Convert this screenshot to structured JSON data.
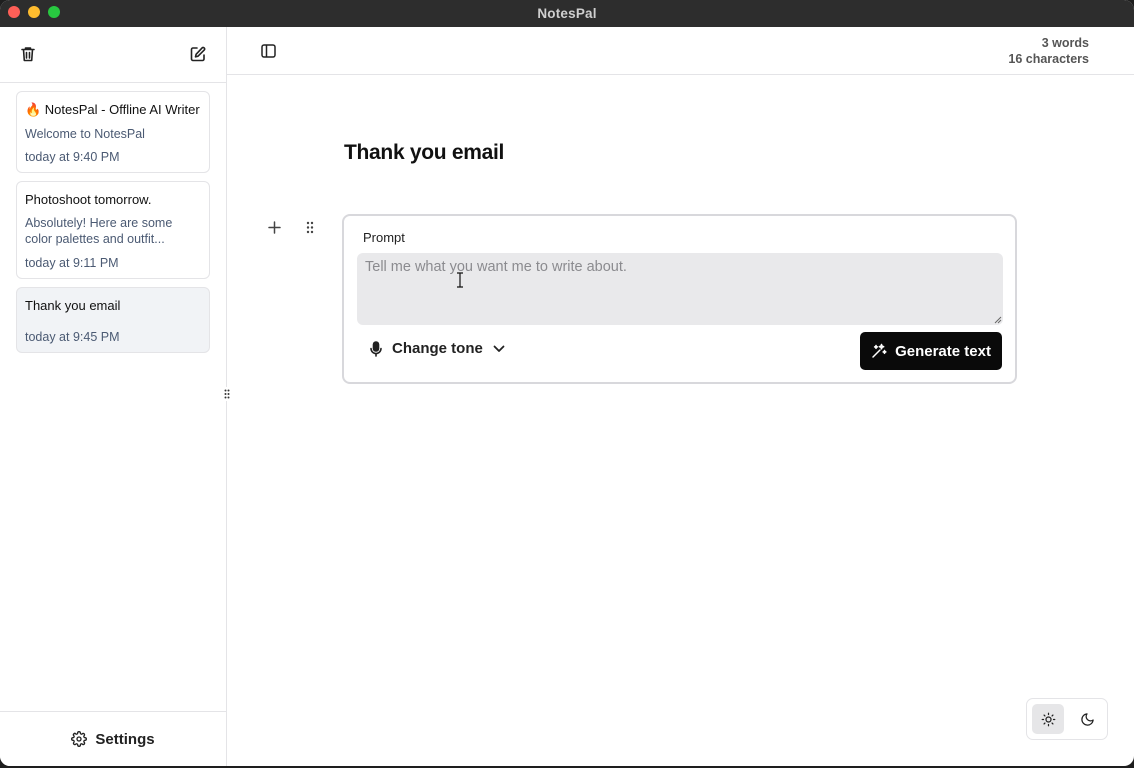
{
  "window": {
    "title": "NotesPal"
  },
  "sidebar": {
    "notes": [
      {
        "title": "🔥 NotesPal - Offline AI Writer",
        "snippet": "Welcome to NotesPal",
        "time": "today at 9:40 PM"
      },
      {
        "title": "Photoshoot tomorrow.",
        "snippet": "Absolutely! Here are some color palettes and outfit...",
        "time": "today at 9:11 PM"
      },
      {
        "title": "Thank you email",
        "snippet": "",
        "time": "today at 9:45 PM"
      }
    ],
    "settings_label": "Settings"
  },
  "header": {
    "words": "3 words",
    "characters": "16 characters"
  },
  "document": {
    "title": "Thank you email"
  },
  "prompt": {
    "label": "Prompt",
    "placeholder": "Tell me what you want me to write about.",
    "tone_label": "Change tone",
    "generate_label": "Generate text"
  },
  "icons": {
    "trash": "trash-icon",
    "compose": "compose-icon",
    "sidebar_toggle": "sidebar-toggle-icon",
    "plus": "plus-icon",
    "drag": "drag-handle-icon",
    "mic": "microphone-icon",
    "chevron": "chevron-down-icon",
    "sparkles": "sparkles-icon",
    "gear": "gear-icon",
    "sun": "sun-icon",
    "moon": "moon-icon"
  },
  "colors": {
    "accent": "#0a0a0a",
    "active_note_bg": "#f1f3f6",
    "muted_text": "#4b5a73"
  }
}
